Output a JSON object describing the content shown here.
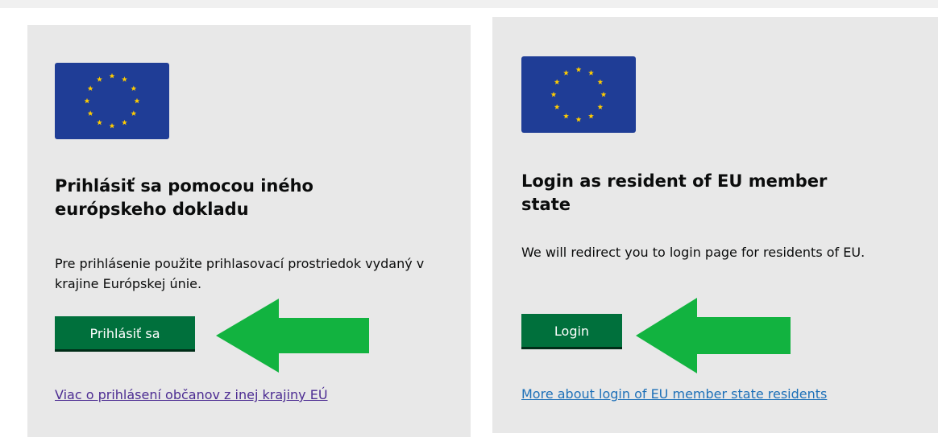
{
  "cards": [
    {
      "flag_icon": "eu-flag-icon",
      "title": "Prihlásiť sa pomocou iného európskeho dokladu",
      "description": "Pre prihlásenie použite prihlasovací prostriedok vydaný v krajine Európskej únie.",
      "button_label": "Prihlásiť sa",
      "link_text": "Viac o prihlásení občanov z inej krajiny EÚ",
      "link_color": "#4c2c92"
    },
    {
      "flag_icon": "eu-flag-icon",
      "title": "Login as resident of EU member state",
      "description": "We will redirect you to login page for residents of EU.",
      "button_label": "Login",
      "link_text": "More about login of EU member state residents",
      "link_color": "#1d70b8"
    }
  ],
  "annotations": {
    "arrow_icon": "arrow-left-icon",
    "arrow_color": "#12b340"
  },
  "colors": {
    "card_background": "#e8e8e8",
    "button_background": "#00703c",
    "flag_blue": "#1f3d96",
    "flag_star": "#ffcc00"
  }
}
